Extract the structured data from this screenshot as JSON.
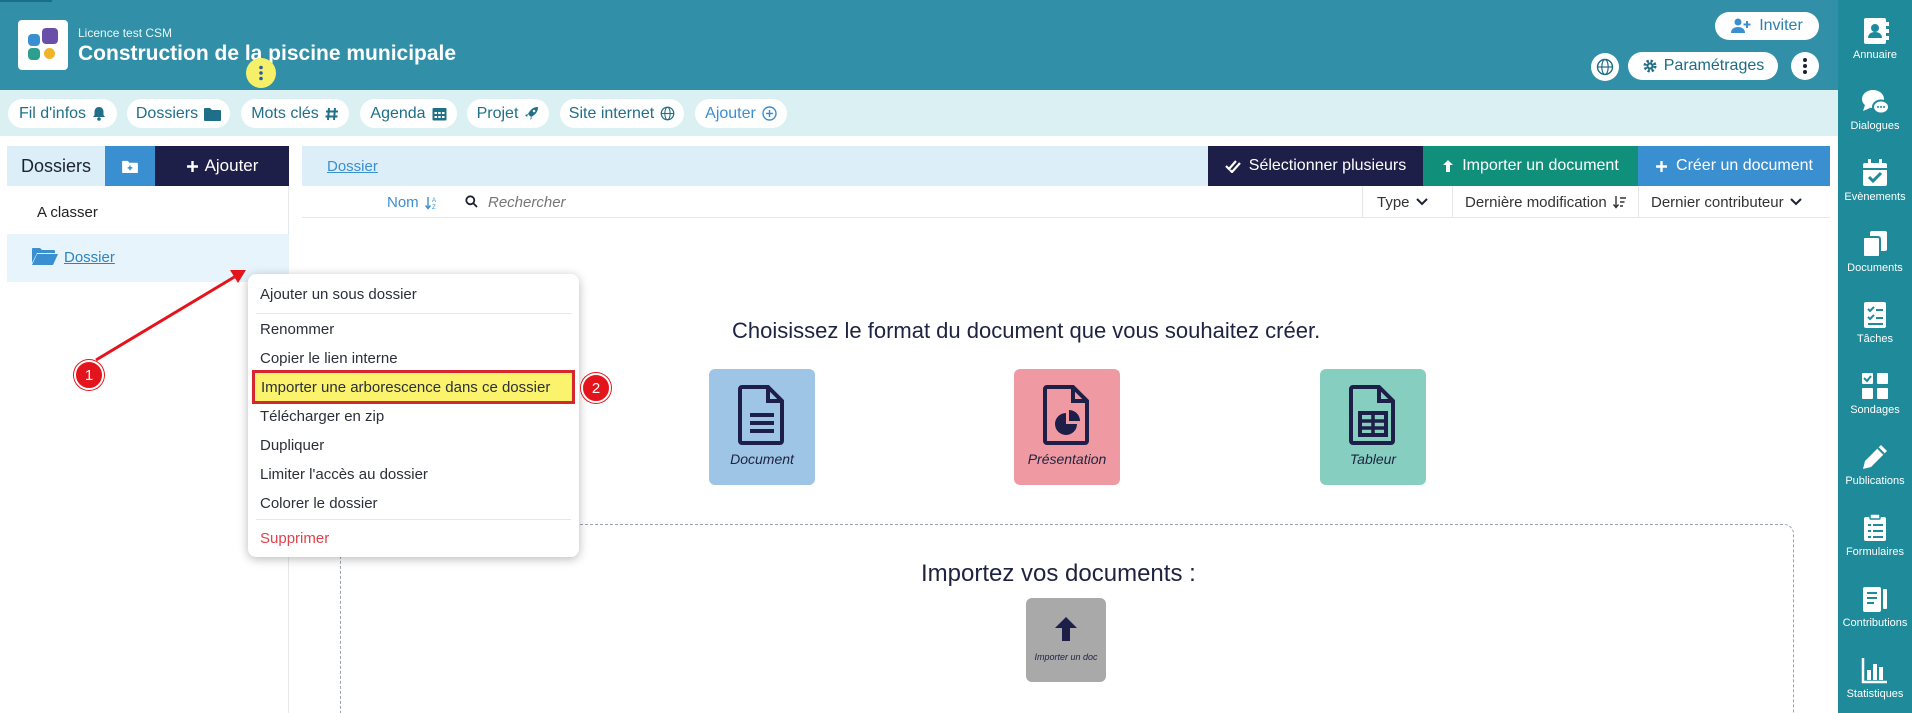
{
  "header": {
    "license": "Licence test CSM",
    "project_title": "Construction de la piscine municipale",
    "invite_label": "Inviter",
    "settings_label": "Paramétrages",
    "logo_colors": [
      "#6a4fa8",
      "#3a8fd1",
      "#2e9e8f",
      "#f0b429"
    ]
  },
  "tabs": [
    {
      "label": "Fil d'infos",
      "icon": "bell-icon"
    },
    {
      "label": "Dossiers",
      "icon": "folder-icon"
    },
    {
      "label": "Mots clés",
      "icon": "hashtag-icon"
    },
    {
      "label": "Agenda",
      "icon": "calendar-icon"
    },
    {
      "label": "Projet",
      "icon": "rocket-icon"
    },
    {
      "label": "Site internet",
      "icon": "globe-icon"
    },
    {
      "label": "Ajouter",
      "icon": "plus-circle-icon"
    }
  ],
  "left_panel": {
    "title": "Dossiers",
    "add_label": "Ajouter",
    "items": [
      {
        "label": "A classer"
      },
      {
        "label": "Dossier"
      }
    ]
  },
  "main": {
    "breadcrumb": "Dossier",
    "select_multiple_label": "Sélectionner plusieurs",
    "import_document_label": "Importer un document",
    "create_document_label": "Créer un document",
    "columns": {
      "name": "Nom",
      "search_placeholder": "Rechercher",
      "type": "Type",
      "last_modified": "Dernière modification",
      "last_contributor": "Dernier contributeur"
    },
    "choose_format_title": "Choisissez le format du document que vous souhaitez créer.",
    "formats": [
      {
        "label": "Document",
        "color": "#9ec4e6"
      },
      {
        "label": "Présentation",
        "color": "#ef9aa2"
      },
      {
        "label": "Tableur",
        "color": "#86cfc0"
      }
    ],
    "import_title": "Importez vos documents :",
    "import_tile_label": "Importer un doc"
  },
  "context_menu": {
    "items": [
      "Ajouter un sous dossier",
      "Renommer",
      "Copier le lien interne",
      "Importer une arborescence dans ce dossier",
      "Télécharger en zip",
      "Dupliquer",
      "Limiter l'accès au dossier",
      "Colorer le dossier",
      "Supprimer"
    ]
  },
  "annotations": {
    "badge_1": "1",
    "badge_2": "2",
    "highlight_color": "#f6f069",
    "arrow_color": "#e3141c"
  },
  "right_sidebar": [
    {
      "label": "Annuaire",
      "icon": "address-book-icon"
    },
    {
      "label": "Dialogues",
      "icon": "chat-icon"
    },
    {
      "label": "Evènements",
      "icon": "calendar-check-icon"
    },
    {
      "label": "Documents",
      "icon": "documents-icon"
    },
    {
      "label": "Tâches",
      "icon": "tasks-icon"
    },
    {
      "label": "Sondages",
      "icon": "poll-icon"
    },
    {
      "label": "Publications",
      "icon": "pen-icon"
    },
    {
      "label": "Formulaires",
      "icon": "form-icon"
    },
    {
      "label": "Contributions",
      "icon": "contributions-icon"
    },
    {
      "label": "Statistiques",
      "icon": "chart-icon"
    }
  ]
}
